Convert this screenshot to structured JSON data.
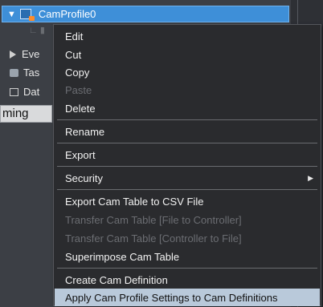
{
  "tree": {
    "selected_label": "CamProfile0",
    "items": [
      {
        "label": "Eve"
      },
      {
        "label": "Tas"
      },
      {
        "label": "Dat"
      }
    ],
    "tab_label": "ming"
  },
  "menu": {
    "items": [
      {
        "label": "Edit",
        "enabled": true
      },
      {
        "label": "Cut",
        "enabled": true
      },
      {
        "label": "Copy",
        "enabled": true
      },
      {
        "label": "Paste",
        "enabled": false
      },
      {
        "label": "Delete",
        "enabled": true
      },
      {
        "label": "Rename",
        "enabled": true
      },
      {
        "label": "Export",
        "enabled": true
      },
      {
        "label": "Security",
        "enabled": true,
        "submenu": true
      },
      {
        "label": "Export Cam Table to CSV File",
        "enabled": true
      },
      {
        "label": "Transfer Cam Table [File to Controller]",
        "enabled": false
      },
      {
        "label": "Transfer Cam Table [Controller to File]",
        "enabled": false
      },
      {
        "label": "Superimpose Cam Table",
        "enabled": true
      },
      {
        "label": "Create Cam Definition",
        "enabled": true
      },
      {
        "label": "Apply Cam Profile Settings to Cam Definitions",
        "enabled": true,
        "highlighted": true
      }
    ]
  }
}
